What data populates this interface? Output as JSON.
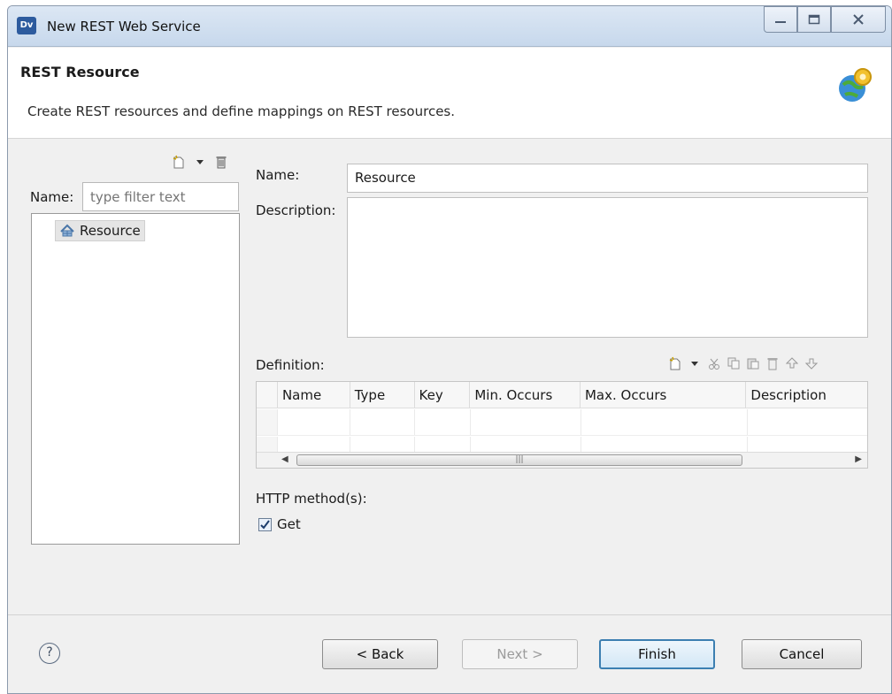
{
  "window": {
    "title": "New REST Web Service",
    "app_icon": "Dv",
    "controls": [
      "minimize",
      "maximize",
      "close"
    ]
  },
  "header": {
    "title": "REST Resource",
    "description": "Create REST resources and define mappings on REST resources.",
    "icon": "globe-gear-icon"
  },
  "left": {
    "filter_label": "Name:",
    "filter_placeholder": "type filter text",
    "toolbar_icons": [
      "new-resource-icon",
      "dropdown-arrow-icon",
      "delete-icon"
    ],
    "tree_items": [
      {
        "label": "Resource",
        "icon": "resource-icon",
        "selected": true
      }
    ]
  },
  "form": {
    "name_label": "Name:",
    "name_value": "Resource",
    "description_label": "Description:",
    "description_value": "",
    "definition_label": "Definition:",
    "definition_toolbar_icons": [
      "new-icon",
      "dropdown-arrow-icon",
      "cut-icon",
      "copy-icon",
      "paste-icon",
      "delete-icon",
      "move-up-icon",
      "move-down-icon"
    ],
    "table_columns": [
      "Name",
      "Type",
      "Key",
      "Min. Occurs",
      "Max. Occurs",
      "Description"
    ],
    "table_rows": [],
    "http_methods_label": "HTTP method(s):",
    "http_methods": [
      {
        "label": "Get",
        "checked": true
      }
    ]
  },
  "footer": {
    "help_icon": "help-icon",
    "back_label": "< Back",
    "next_label": "Next >",
    "finish_label": "Finish",
    "cancel_label": "Cancel"
  }
}
